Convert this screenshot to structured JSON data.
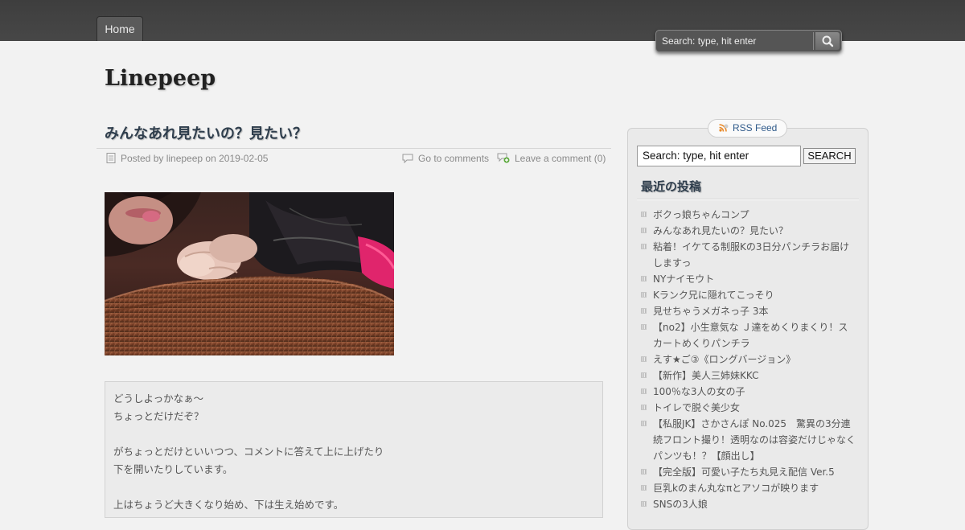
{
  "nav": {
    "home_label": "Home"
  },
  "header_search": {
    "placeholder": "Search: type, hit enter"
  },
  "site": {
    "title": "Linepeep"
  },
  "post": {
    "title": "みんなあれ見たいの？見たい？",
    "author_label": "Posted by linepeep on 2019-02-05",
    "comments_link": "Go to comments",
    "leave_comment": "Leave a comment (0)",
    "image_icon": "post-photo",
    "content_lines": [
      "どうしよっかなぁ～",
      "ちょっとだけだぞ？",
      "",
      "がちょっとだけといいつつ、コメントに答えて上に上げたり",
      "下を開いたりしています。",
      "",
      "上はちょうど大きくなり始め、下は生え始めです。"
    ]
  },
  "sidebar": {
    "rss_label": "RSS Feed",
    "search_value": "Search: type, hit enter",
    "search_button": "SEARCH",
    "recent_title": "最近の投稿",
    "recent_posts": [
      "ボクっ娘ちゃんコンプ",
      "みんなあれ見たいの？見たい？",
      "粘着！イケてる制服Kの3日分パンチラお届けしますっ",
      "NYナイモウト",
      "Kランク兄に隠れてこっそり",
      "見せちゃうメガネっ子 3本",
      "【no2】小生意気な Ｊ達をめくりまくり！スカートめくりパンチラ",
      "えす★ご③《ロングバージョン》",
      "【新作】美人三姉妹KKC",
      "100％な3人の女の子",
      "トイレで脱ぐ美少女",
      "【私服JK】さかさんぽ No.025　驚異の3分連続フロント撮り！透明なのは容姿だけじゃなくパンツも！？【顔出し】",
      "【完全版】可愛い子たち丸見え配信 Ver.5",
      "巨乳kのまん丸なπとアソコが映ります",
      "SNSの3人娘"
    ]
  }
}
